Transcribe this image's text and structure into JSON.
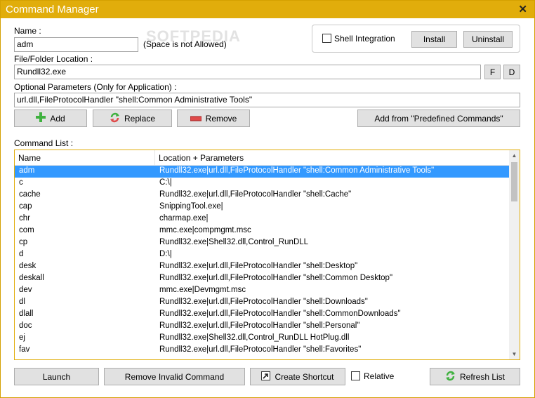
{
  "window": {
    "title": "Command Manager",
    "close_glyph": "✕"
  },
  "form": {
    "name_label": "Name :",
    "name_value": "adm",
    "name_hint": "(Space is not Allowed)",
    "location_label": "File/Folder Location :",
    "location_value": "Rundll32.exe",
    "browse_file_label": "F",
    "browse_dir_label": "D",
    "params_label": "Optional Parameters (Only for Application) :",
    "params_value": "url.dll,FileProtocolHandler \"shell:Common Administrative Tools\""
  },
  "shell": {
    "integration_label": "Shell Integration",
    "install_label": "Install",
    "uninstall_label": "Uninstall"
  },
  "actions": {
    "add_label": "Add",
    "replace_label": "Replace",
    "remove_label": "Remove",
    "predefined_label": "Add from \"Predefined Commands\""
  },
  "list": {
    "label": "Command List :",
    "columns": [
      "Name",
      "Location + Parameters"
    ],
    "rows": [
      {
        "name": "adm",
        "location": "Rundll32.exe|url.dll,FileProtocolHandler \"shell:Common Administrative Tools\""
      },
      {
        "name": "c",
        "location": "C:\\|"
      },
      {
        "name": "cache",
        "location": "Rundll32.exe|url.dll,FileProtocolHandler \"shell:Cache\""
      },
      {
        "name": "cap",
        "location": "SnippingTool.exe|"
      },
      {
        "name": "chr",
        "location": "charmap.exe|"
      },
      {
        "name": "com",
        "location": "mmc.exe|compmgmt.msc"
      },
      {
        "name": "cp",
        "location": "Rundll32.exe|Shell32.dll,Control_RunDLL"
      },
      {
        "name": "d",
        "location": "D:\\|"
      },
      {
        "name": "desk",
        "location": "Rundll32.exe|url.dll,FileProtocolHandler \"shell:Desktop\""
      },
      {
        "name": "deskall",
        "location": "Rundll32.exe|url.dll,FileProtocolHandler \"shell:Common Desktop\""
      },
      {
        "name": "dev",
        "location": "mmc.exe|Devmgmt.msc"
      },
      {
        "name": "dl",
        "location": "Rundll32.exe|url.dll,FileProtocolHandler \"shell:Downloads\""
      },
      {
        "name": "dlall",
        "location": "Rundll32.exe|url.dll,FileProtocolHandler \"shell:CommonDownloads\""
      },
      {
        "name": "doc",
        "location": "Rundll32.exe|url.dll,FileProtocolHandler \"shell:Personal\""
      },
      {
        "name": "ej",
        "location": "Rundll32.exe|Shell32.dll,Control_RunDLL HotPlug.dll"
      },
      {
        "name": "fav",
        "location": "Rundll32.exe|url.dll,FileProtocolHandler \"shell:Favorites\""
      }
    ]
  },
  "footer": {
    "launch_label": "Launch",
    "remove_invalid_label": "Remove Invalid Command",
    "create_shortcut_label": "Create Shortcut",
    "relative_label": "Relative",
    "refresh_label": "Refresh List"
  },
  "watermark": "SOFTPEDIA",
  "colors": {
    "title_bar": "#e1ad0b",
    "selection": "#3399ff",
    "add_icon": "#3fb13f",
    "remove_icon": "#e04a4a"
  },
  "icons": {
    "add": "plus-icon",
    "replace": "replace-icon",
    "remove": "minus-icon",
    "shortcut": "shortcut-icon",
    "refresh": "refresh-icon"
  }
}
